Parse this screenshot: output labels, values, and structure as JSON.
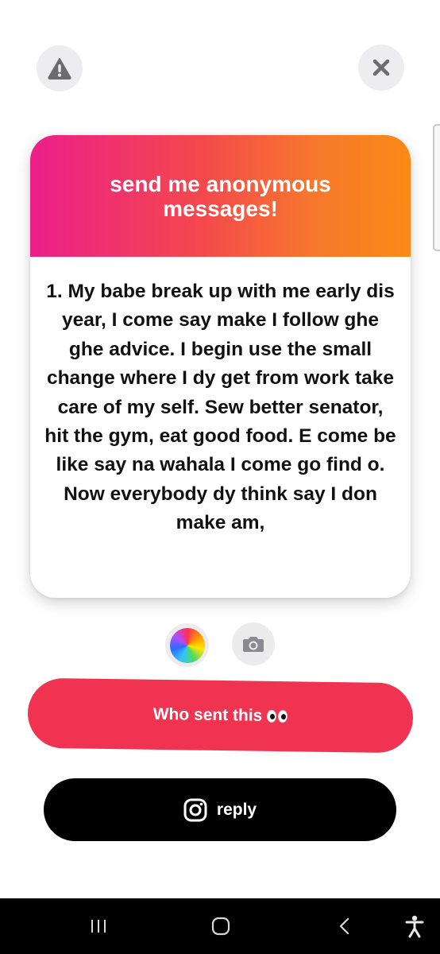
{
  "header": {
    "report_icon": "warning-icon",
    "close_icon": "close-icon"
  },
  "card": {
    "title": "send me anonymous messages!",
    "message": "1. My babe break up with me early dis year, I come say make I follow ghe ghe advice. I begin use the small change where I dy get from work take care of my self. Sew better senator, hit the gym, eat good food. E come be like say na wahala I come go find o. Now everybody dy think say I don make am,",
    "gradient_colors": [
      "#ec1f8a",
      "#f4484d",
      "#fa8a17"
    ]
  },
  "tools": {
    "color_icon": "color-wheel-icon",
    "camera_icon": "camera-icon"
  },
  "buttons": {
    "who_sent_label": "Who sent this",
    "who_sent_emoji": "eyes-icon",
    "who_sent_color": "#ef3350",
    "reply_label": "reply",
    "reply_icon": "instagram-icon",
    "reply_color": "#000000"
  },
  "navbar": {
    "items": [
      "recent-apps-icon",
      "home-icon",
      "back-icon",
      "accessibility-icon"
    ]
  }
}
